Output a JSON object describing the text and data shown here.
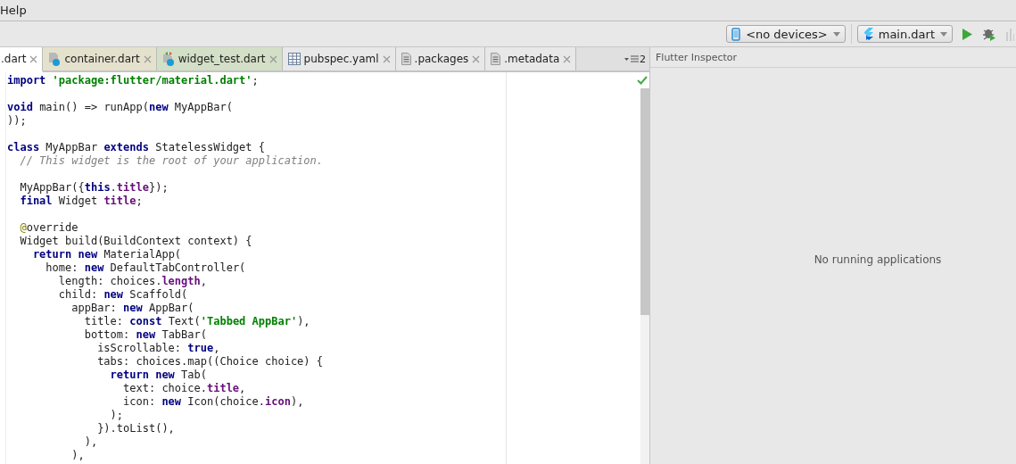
{
  "menu_bar": {
    "items": [
      "Help"
    ]
  },
  "toolbar": {
    "device_selector": "<no devices>",
    "run_config": "main.dart"
  },
  "tabs": [
    {
      "label": ".dart",
      "selected": true,
      "color": "#ffffff",
      "kind": "plain"
    },
    {
      "label": "container.dart",
      "selected": false,
      "color": "#e4e1cd",
      "kind": "dart"
    },
    {
      "label": "widget_test.dart",
      "selected": false,
      "color": "#d3dfc6",
      "kind": "test"
    },
    {
      "label": "pubspec.yaml",
      "selected": false,
      "color": "#e8e8e8",
      "kind": "yaml"
    },
    {
      "label": ".packages",
      "selected": false,
      "color": "#e8e8e8",
      "kind": "text"
    },
    {
      "label": ".metadata",
      "selected": false,
      "color": "#e8e8e8",
      "kind": "text"
    }
  ],
  "tab_overflow_count": "2",
  "editor": {
    "lines": [
      {
        "blank_before": false,
        "tokens": [
          {
            "kind": "keyword",
            "text": "import"
          },
          {
            "kind": "string",
            "text": " 'package:flutter/material.dart'"
          },
          {
            "kind": "plain",
            "text": ";"
          }
        ]
      },
      {
        "blank_before": true,
        "tokens": [
          {
            "kind": "keyword",
            "text": "void"
          },
          {
            "kind": "plain",
            "text": " main() => runApp("
          },
          {
            "kind": "keyword",
            "text": "new"
          },
          {
            "kind": "plain",
            "text": " MyAppBar("
          }
        ]
      },
      {
        "blank_before": false,
        "tokens": [
          {
            "kind": "plain",
            "text": "));"
          }
        ]
      },
      {
        "blank_before": true,
        "tokens": [
          {
            "kind": "keyword",
            "text": "class"
          },
          {
            "kind": "plain",
            "text": " MyAppBar "
          },
          {
            "kind": "keyword",
            "text": "extends"
          },
          {
            "kind": "plain",
            "text": " StatelessWidget {"
          }
        ]
      },
      {
        "blank_before": false,
        "tokens": [
          {
            "kind": "comment",
            "text": "  // This widget is the root of your application."
          }
        ]
      },
      {
        "blank_before": true,
        "tokens": [
          {
            "kind": "plain",
            "text": "  MyAppBar({"
          },
          {
            "kind": "keyword",
            "text": "this"
          },
          {
            "kind": "plain",
            "text": "."
          },
          {
            "kind": "field",
            "text": "title"
          },
          {
            "kind": "plain",
            "text": "});"
          }
        ]
      },
      {
        "blank_before": false,
        "tokens": [
          {
            "kind": "keyword",
            "text": "  final"
          },
          {
            "kind": "plain",
            "text": " Widget "
          },
          {
            "kind": "field",
            "text": "title"
          },
          {
            "kind": "plain",
            "text": ";"
          }
        ]
      },
      {
        "blank_before": true,
        "tokens": [
          {
            "kind": "annotation",
            "text": "  @"
          },
          {
            "kind": "plain",
            "text": "override"
          }
        ]
      },
      {
        "blank_before": false,
        "tokens": [
          {
            "kind": "plain",
            "text": "  Widget build(BuildContext context) {"
          }
        ]
      },
      {
        "blank_before": false,
        "tokens": [
          {
            "kind": "keyword",
            "text": "    return new"
          },
          {
            "kind": "plain",
            "text": " MaterialApp("
          }
        ]
      },
      {
        "blank_before": false,
        "tokens": [
          {
            "kind": "plain",
            "text": "      home: "
          },
          {
            "kind": "keyword",
            "text": "new"
          },
          {
            "kind": "plain",
            "text": " DefaultTabController("
          }
        ]
      },
      {
        "blank_before": false,
        "tokens": [
          {
            "kind": "plain",
            "text": "        length: choices."
          },
          {
            "kind": "field",
            "text": "length"
          },
          {
            "kind": "plain",
            "text": ","
          }
        ]
      },
      {
        "blank_before": false,
        "tokens": [
          {
            "kind": "plain",
            "text": "        child: "
          },
          {
            "kind": "keyword",
            "text": "new"
          },
          {
            "kind": "plain",
            "text": " Scaffold("
          }
        ]
      },
      {
        "blank_before": false,
        "tokens": [
          {
            "kind": "plain",
            "text": "          appBar: "
          },
          {
            "kind": "keyword",
            "text": "new"
          },
          {
            "kind": "plain",
            "text": " AppBar("
          }
        ]
      },
      {
        "blank_before": false,
        "tokens": [
          {
            "kind": "plain",
            "text": "            title: "
          },
          {
            "kind": "keyword",
            "text": "const"
          },
          {
            "kind": "plain",
            "text": " Text("
          },
          {
            "kind": "string",
            "text": "'Tabbed AppBar'"
          },
          {
            "kind": "plain",
            "text": "),"
          }
        ]
      },
      {
        "blank_before": false,
        "tokens": [
          {
            "kind": "plain",
            "text": "            bottom: "
          },
          {
            "kind": "keyword",
            "text": "new"
          },
          {
            "kind": "plain",
            "text": " TabBar("
          }
        ]
      },
      {
        "blank_before": false,
        "tokens": [
          {
            "kind": "plain",
            "text": "              isScrollable: "
          },
          {
            "kind": "keyword",
            "text": "true"
          },
          {
            "kind": "plain",
            "text": ","
          }
        ]
      },
      {
        "blank_before": false,
        "tokens": [
          {
            "kind": "plain",
            "text": "              tabs: choices.map((Choice choice) {"
          }
        ]
      },
      {
        "blank_before": false,
        "tokens": [
          {
            "kind": "keyword",
            "text": "                return new"
          },
          {
            "kind": "plain",
            "text": " Tab("
          }
        ]
      },
      {
        "blank_before": false,
        "tokens": [
          {
            "kind": "plain",
            "text": "                  text: choice."
          },
          {
            "kind": "field",
            "text": "title"
          },
          {
            "kind": "plain",
            "text": ","
          }
        ]
      },
      {
        "blank_before": false,
        "tokens": [
          {
            "kind": "plain",
            "text": "                  icon: "
          },
          {
            "kind": "keyword",
            "text": "new"
          },
          {
            "kind": "plain",
            "text": " Icon(choice."
          },
          {
            "kind": "field",
            "text": "icon"
          },
          {
            "kind": "plain",
            "text": "),"
          }
        ]
      },
      {
        "blank_before": false,
        "tokens": [
          {
            "kind": "plain",
            "text": "                );"
          }
        ]
      },
      {
        "blank_before": false,
        "tokens": [
          {
            "kind": "plain",
            "text": "              }).toList(),"
          }
        ]
      },
      {
        "blank_before": false,
        "tokens": [
          {
            "kind": "plain",
            "text": "            ),"
          }
        ]
      },
      {
        "blank_before": false,
        "tokens": [
          {
            "kind": "plain",
            "text": "          ),"
          }
        ]
      }
    ]
  },
  "inspector": {
    "title": "Flutter Inspector",
    "empty_message": "No running applications"
  }
}
